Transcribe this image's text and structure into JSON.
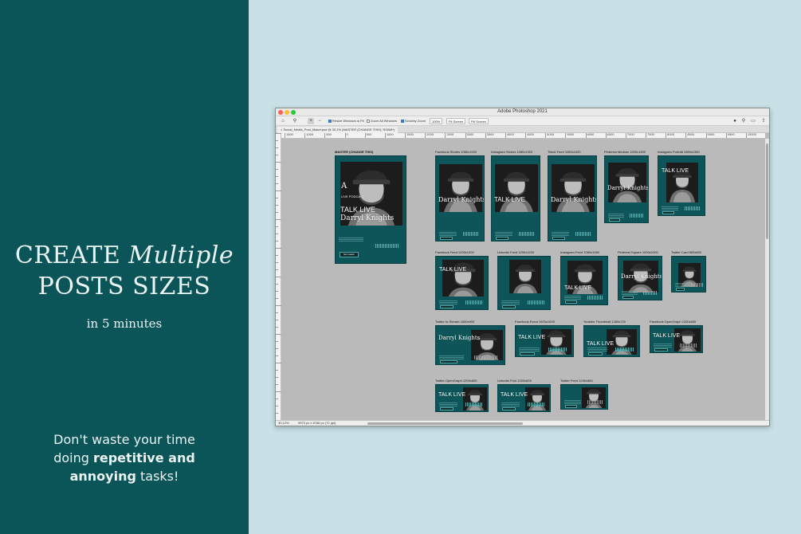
{
  "promo": {
    "headline_pre": "CREATE ",
    "headline_em": "Multiple",
    "headline_line2": "POSTS SIZES",
    "subline": "in 5 minutes",
    "tagline_1": "Don't waste your time",
    "tagline_2a": "doing ",
    "tagline_2b": "repetitive and",
    "tagline_3a": "annoying",
    "tagline_3b": " tasks!"
  },
  "colors": {
    "panel": "#0b5457",
    "background": "#c8e0e6",
    "post": "#0d5558"
  },
  "photoshop": {
    "app_title": "Adobe Photoshop 2021",
    "options": {
      "resize_windows": "Resize Windows to Fit",
      "zoom_all": "Zoom All Windows",
      "scrubby_zoom": "Scrubby Zoom",
      "zoom_percent": "100%",
      "fit_screen": "Fit Screen",
      "fill_screen": "Fill Screen"
    },
    "doc_tab": "Social_Media_Post_Maker.psd @ 30,1% (MASTER (CHANGE THIS), RGB/8*)",
    "ruler_ticks": [
      "1500",
      "1000",
      "500",
      "0",
      "500",
      "1000",
      "1500",
      "2000",
      "2500",
      "3000",
      "3500",
      "4000",
      "4500",
      "5000",
      "5500",
      "6000",
      "6500",
      "7000",
      "7500",
      "8000",
      "8500",
      "9000",
      "9500",
      "10000"
    ],
    "status_zoom": "30,12%",
    "status_doc": "9973 px x 8786 px (72 ppi)",
    "artboards": [
      {
        "label": "MASTER (CHANGE THIS)",
        "brand": "A",
        "kicker": "LIVE PODCAST",
        "title": "TALK LIVE",
        "subtitle": "Darryl Knights",
        "button": "Set reader"
      },
      {
        "label": "Facebook Stories 1080x1920",
        "title": "Darryl Knights"
      },
      {
        "label": "Instagram Stories 1080x1920",
        "title": "TALK LIVE"
      },
      {
        "label": "Tiktok Feed 1080x1920",
        "title": "Darryl Knights"
      },
      {
        "label": "Pinterest Medium 1000x1500",
        "title": "Darryl Knights"
      },
      {
        "label": "Instagram Portrait 1080x1350",
        "title": "TALK LIVE"
      },
      {
        "label": "Facebook Feed 1200x1200",
        "title": "TALK LIVE"
      },
      {
        "label": "Linkedin Feed 1200x1200",
        "title": ""
      },
      {
        "label": "Instagram Feed 1080x1080",
        "title": "TALK LIVE"
      },
      {
        "label": "Pinterest Square 1000x1000",
        "title": "Darryl Knights"
      },
      {
        "label": "Twitter Card 800x800",
        "title": ""
      },
      {
        "label": "Twitter In-Stream 1600x900",
        "title": "Darryl Knights"
      },
      {
        "label": "Facebook Event 1920x1005",
        "title": "TALK LIVE"
      },
      {
        "label": "Youtube Thumbnail 1280x720",
        "title": "TALK LIVE"
      },
      {
        "label": "Facebook OpenGraph 1200x630",
        "title": "TALK LIVE"
      },
      {
        "label": "Twitter OpenGraph 1200x600",
        "title": "TALK LIVE"
      },
      {
        "label": "Linkedin Post 1200x628",
        "title": "TALK LIVE"
      },
      {
        "label": "Twitter Feed 1240x584",
        "title": ""
      }
    ]
  }
}
